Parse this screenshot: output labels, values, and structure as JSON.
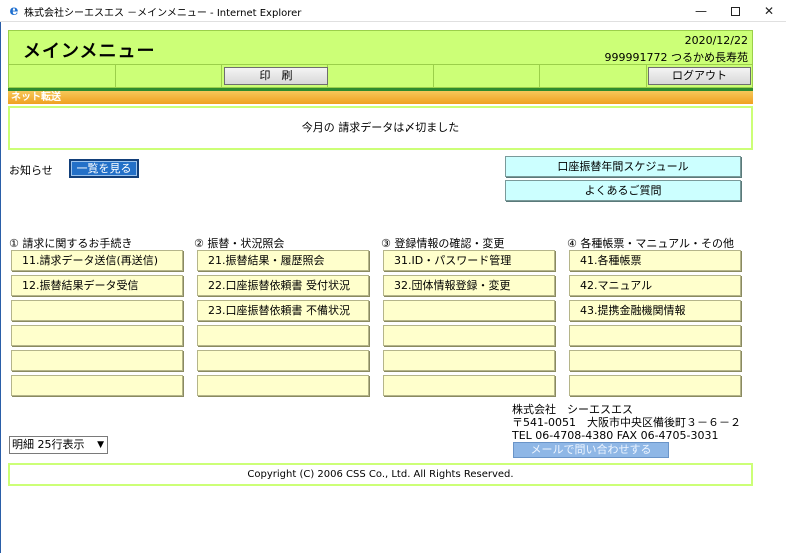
{
  "window": {
    "title": "株式会社シーエスエス －メインメニュー - Internet Explorer",
    "minimize": "—",
    "close": "✕"
  },
  "header": {
    "title": "メインメニュー",
    "date": "2020/12/22",
    "user": "999991772 つるかめ長寿苑"
  },
  "toolbar": {
    "print_label": "印　刷",
    "logout_label": "ログアウト"
  },
  "section": {
    "label": "ネット転送"
  },
  "notice": {
    "message": "今月の 請求データは〆切ました"
  },
  "news": {
    "label": "お知らせ",
    "view_all": "一覧を見る"
  },
  "links": {
    "schedule": "口座振替年間スケジュール",
    "faq": "よくあるご質問"
  },
  "columns": [
    {
      "title": "① 請求に関するお手続き",
      "items": [
        "11.請求データ送信(再送信)",
        "12.振替結果データ受信",
        "",
        "",
        "",
        ""
      ]
    },
    {
      "title": "② 振替・状況照会",
      "items": [
        "21.振替結果・履歴照会",
        "22.口座振替依頼書 受付状況",
        "23.口座振替依頼書 不備状況",
        "",
        "",
        ""
      ]
    },
    {
      "title": "③ 登録情報の確認・変更",
      "items": [
        "31.ID・パスワード管理",
        "32.団体情報登録・変更",
        "",
        "",
        "",
        ""
      ]
    },
    {
      "title": "④ 各種帳票・マニュアル・その他",
      "items": [
        "41.各種帳票",
        "42.マニュアル",
        "43.提携金融機関情報",
        "",
        "",
        ""
      ]
    }
  ],
  "company": {
    "name": "株式会社　シーエスエス",
    "address": "〒541-0051　大阪市中央区備後町３－６－２",
    "phone": "TEL 06-4708-4380  FAX 06-4705-3031",
    "mail_button": "メールで問い合わせする"
  },
  "rows_select": {
    "selected": "明細 25行表示"
  },
  "footer": {
    "copyright": "Copyright (C) 2006 CSS Co., Ltd. All Rights Reserved."
  }
}
